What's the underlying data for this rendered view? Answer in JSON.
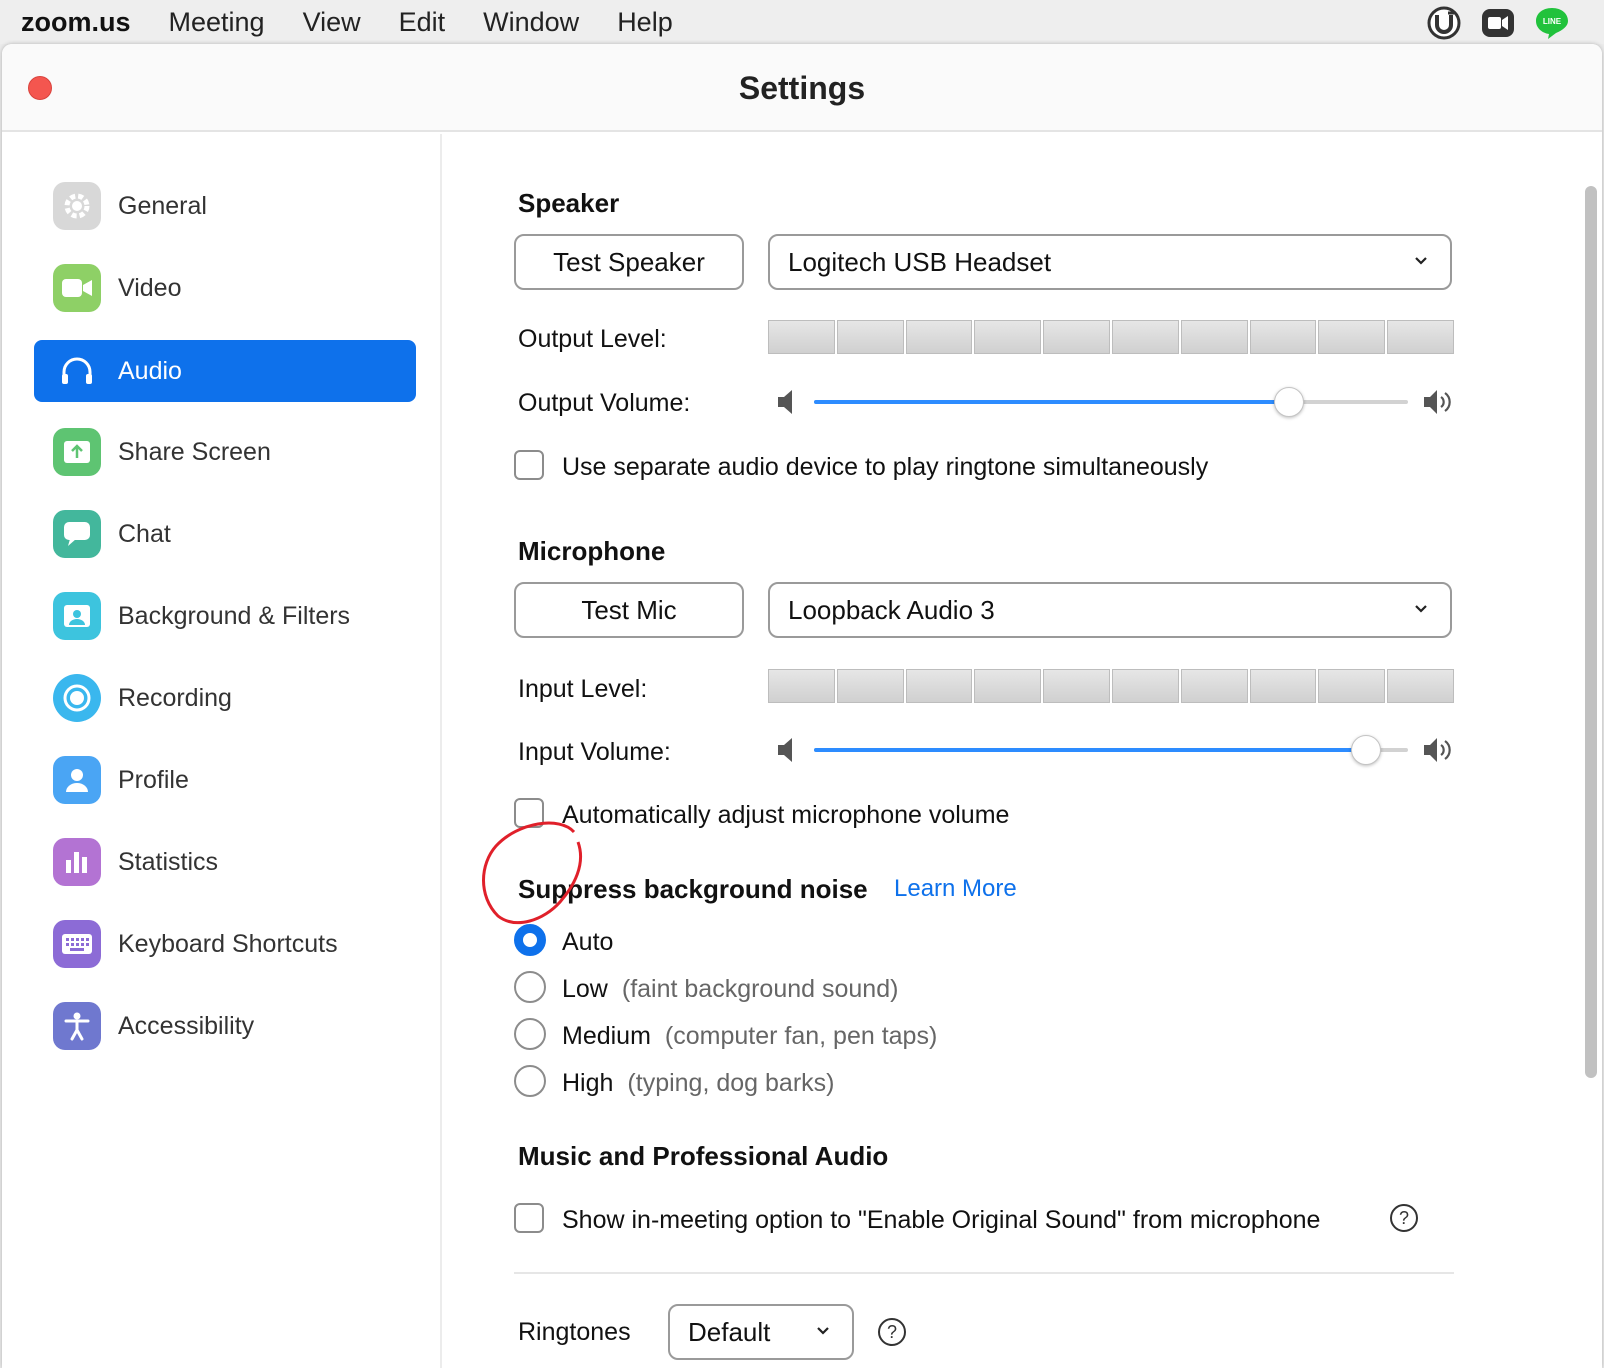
{
  "menubar": {
    "app_name": "zoom.us",
    "menus": [
      "Meeting",
      "View",
      "Edit",
      "Window",
      "Help"
    ],
    "tray_icons": [
      "utorrent-icon",
      "zoom-icon",
      "line-icon"
    ],
    "line_badge": "LINE"
  },
  "window": {
    "title": "Settings"
  },
  "sidebar": {
    "items": [
      {
        "label": "General",
        "icon": "gear-icon",
        "color": "#d8d8d8"
      },
      {
        "label": "Video",
        "icon": "video-camera-icon",
        "color": "#8ed066"
      },
      {
        "label": "Audio",
        "icon": "headphones-icon",
        "color": "#0e71eb",
        "active": true
      },
      {
        "label": "Share Screen",
        "icon": "share-screen-icon",
        "color": "#5ec472"
      },
      {
        "label": "Chat",
        "icon": "chat-bubble-icon",
        "color": "#43b79c"
      },
      {
        "label": "Background & Filters",
        "icon": "background-icon",
        "color": "#3dc4de"
      },
      {
        "label": "Recording",
        "icon": "record-icon",
        "color": "#3ab7ee"
      },
      {
        "label": "Profile",
        "icon": "person-icon",
        "color": "#4aa5f4"
      },
      {
        "label": "Statistics",
        "icon": "bar-chart-icon",
        "color": "#b373d3"
      },
      {
        "label": "Keyboard Shortcuts",
        "icon": "keyboard-icon",
        "color": "#8c6bd6"
      },
      {
        "label": "Accessibility",
        "icon": "accessibility-icon",
        "color": "#6f78cf"
      }
    ]
  },
  "speaker": {
    "title": "Speaker",
    "test_button": "Test Speaker",
    "device": "Logitech USB Headset",
    "output_level_label": "Output Level:",
    "output_volume_label": "Output Volume:",
    "output_volume_value": 0.8,
    "ringtone_checkbox_label": "Use separate audio device to play ringtone simultaneously",
    "ringtone_checked": false
  },
  "microphone": {
    "title": "Microphone",
    "test_button": "Test Mic",
    "device": "Loopback Audio 3",
    "input_level_label": "Input Level:",
    "input_volume_label": "Input Volume:",
    "input_volume_value": 0.93,
    "auto_adjust_label": "Automatically adjust microphone volume",
    "auto_adjust_checked": false
  },
  "noise": {
    "title": "Suppress background noise",
    "learn_more": "Learn More",
    "options": [
      {
        "label": "Auto",
        "hint": "",
        "selected": true
      },
      {
        "label": "Low",
        "hint": "(faint background sound)",
        "selected": false
      },
      {
        "label": "Medium",
        "hint": "(computer fan, pen taps)",
        "selected": false
      },
      {
        "label": "High",
        "hint": "(typing, dog barks)",
        "selected": false
      }
    ]
  },
  "music": {
    "title": "Music and Professional Audio",
    "original_sound_label": "Show in-meeting option to \"Enable Original Sound\" from microphone",
    "original_sound_checked": false,
    "help": "?"
  },
  "ringtones": {
    "label": "Ringtones",
    "value": "Default",
    "help": "?"
  },
  "colors": {
    "accent": "#0e71eb",
    "slider_fill": "#2d8cff",
    "annotation": "#e0202a",
    "close": "#f4564f"
  }
}
